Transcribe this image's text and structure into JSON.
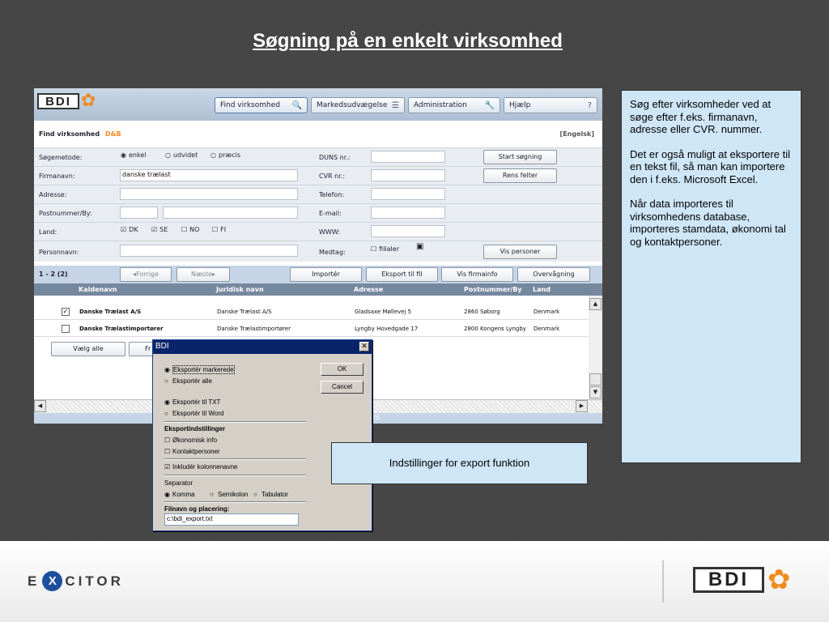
{
  "slide": {
    "title": "Søgning på en enkelt virksomhed"
  },
  "app": {
    "logo_text": "BDI",
    "nav": [
      {
        "label": "Find virksomhed",
        "icon": "search-icon",
        "glyph": "🔍"
      },
      {
        "label": "Markedsudvægelse",
        "icon": "list-icon",
        "glyph": "☰"
      },
      {
        "label": "Administration",
        "icon": "wrench-icon",
        "glyph": "🔧"
      },
      {
        "label": "Hjælp",
        "icon": "help-icon",
        "glyph": "?"
      }
    ],
    "form": {
      "title": "Find virksomhed",
      "source": "D&B",
      "language_link": "[Engelsk]",
      "search_method_label": "Søgemetode:",
      "search_methods": [
        "enkel",
        "udvidet",
        "præcis"
      ],
      "company_name_label": "Firmanavn:",
      "company_name_value": "danske trælast",
      "address_label": "Adresse:",
      "postal_label": "Postnummer/By:",
      "country_label": "Land:",
      "countries": [
        {
          "code": "DK",
          "checked": true
        },
        {
          "code": "SE",
          "checked": true
        },
        {
          "code": "NO",
          "checked": false
        },
        {
          "code": "FI",
          "checked": false
        }
      ],
      "person_label": "Personnavn:",
      "duns_label": "DUNS nr.:",
      "cvr_label": "CVR nr.:",
      "phone_label": "Telefon:",
      "email_label": "E-mail:",
      "www_label": "WWW:",
      "include_label": "Medtag:",
      "branches_label": "filialer",
      "start_search": "Start søgning",
      "clear_fields": "Rens felter",
      "show_persons": "Vis personer"
    },
    "results": {
      "count": "1 - 2  (2)",
      "prev": "◂Forrige",
      "next": "Næste▸",
      "import": "Importér",
      "export": "Eksport til fil",
      "show_info": "Vis firmainfo",
      "monitoring": "Overvågning",
      "columns": [
        "Kaldenavn",
        "Juridisk navn",
        "Adresse",
        "Postnummer/By",
        "Land"
      ],
      "rows": [
        {
          "checked": true,
          "name": "Danske Trælast A/S",
          "legal": "Danske Trælast A/S",
          "address": "Gladsaxe Møllevej 5",
          "postal": "2860 Søborg",
          "country": "Denmark"
        },
        {
          "checked": false,
          "name": "Danske Trælastimportører",
          "legal": "Danske Trælastimportører",
          "address": "Lyngby Hovedgade 17",
          "postal": "2800 Kongens Lyngby",
          "country": "Denmark"
        }
      ],
      "select_all": "Vælg alle",
      "hidden_button_fragment": "Fr",
      "footer_fragment": "/S"
    }
  },
  "dialog": {
    "title": "BDI",
    "ok": "OK",
    "cancel": "Cancel",
    "export_selected": "Eksportér markerede",
    "export_all": "Eksportér alle",
    "export_txt": "Eksportér til TXT",
    "export_word": "Eksportér til Word",
    "settings_heading": "Eksportindstillinger",
    "economic_info": "Økonomisk info",
    "contacts": "Kontaktpersoner",
    "include_columns": "Inkludér kolonnenavne",
    "separator_heading": "Separator",
    "comma": "Komma",
    "semicolon": "Semikolon",
    "tab": "Tabulator",
    "filename_heading": "Filnavn og placering:",
    "filename_value": "c:\\bdi_export.txt"
  },
  "notes": {
    "p1": "Søg efter virksomheder ved at søge efter f.eks. firmanavn, adresse eller CVR. nummer.",
    "p2": "Det er også muligt at eksportere til en tekst fil, så man kan importere den i f.eks. Microsoft Excel.",
    "p3": "Når data importeres til virksomhedens database, importeres stamdata, økonomi tal og kontaktpersoner."
  },
  "caption": "Indstillinger for export funktion",
  "footer": {
    "excitor_pre": "E",
    "excitor_x": "X",
    "excitor_post": "CITOR",
    "bdi_logo": "BDI"
  }
}
